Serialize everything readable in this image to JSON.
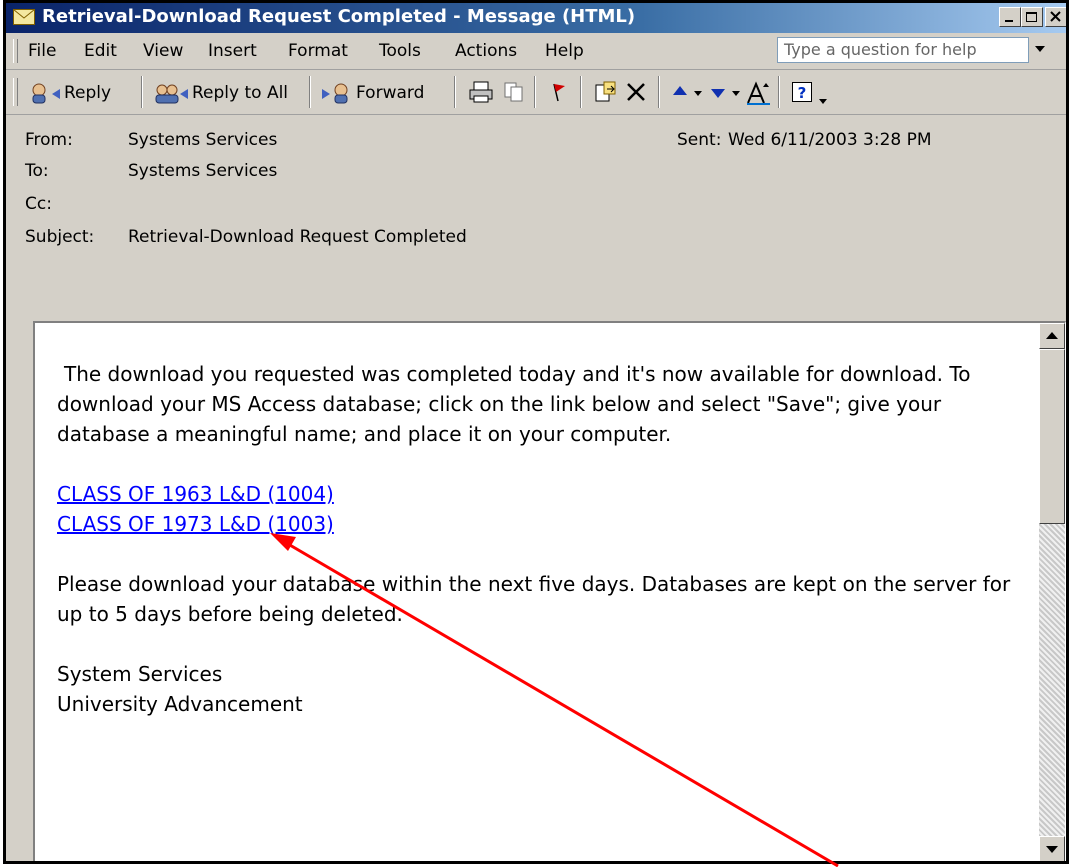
{
  "window": {
    "title": "Retrieval-Download Request Completed - Message (HTML)"
  },
  "menu": {
    "items": [
      "File",
      "Edit",
      "View",
      "Insert",
      "Format",
      "Tools",
      "Actions",
      "Help"
    ],
    "help_placeholder": "Type a question for help"
  },
  "toolbar": {
    "reply": "Reply",
    "reply_all": "Reply to All",
    "forward": "Forward"
  },
  "header": {
    "from_label": "From:",
    "from_value": "Systems Services",
    "to_label": "To:",
    "to_value": "Systems Services",
    "cc_label": "Cc:",
    "cc_value": "",
    "subject_label": "Subject:",
    "subject_value": "Retrieval-Download Request Completed",
    "sent_label": "Sent:",
    "sent_value": "Wed 6/11/2003 3:28 PM"
  },
  "message": {
    "paragraph1": "The download you requested was completed today and it's now available for download.  To download your MS Access database; click on the link below and select \"Save\"; give your database a meaningful name; and place it on your computer.",
    "links": [
      "CLASS OF 1963 L&D (1004)",
      "CLASS OF 1973 L&D (1003)"
    ],
    "paragraph2": "Please download your database within the next five days.  Databases are kept on the server for up to 5 days before being deleted.",
    "signature_line1": "System Services",
    "signature_line2": "University Advancement"
  },
  "colors": {
    "title_start": "#0a246a",
    "title_end": "#a6caf0",
    "link": "#0000ff",
    "annotation_arrow": "#ff0000"
  }
}
